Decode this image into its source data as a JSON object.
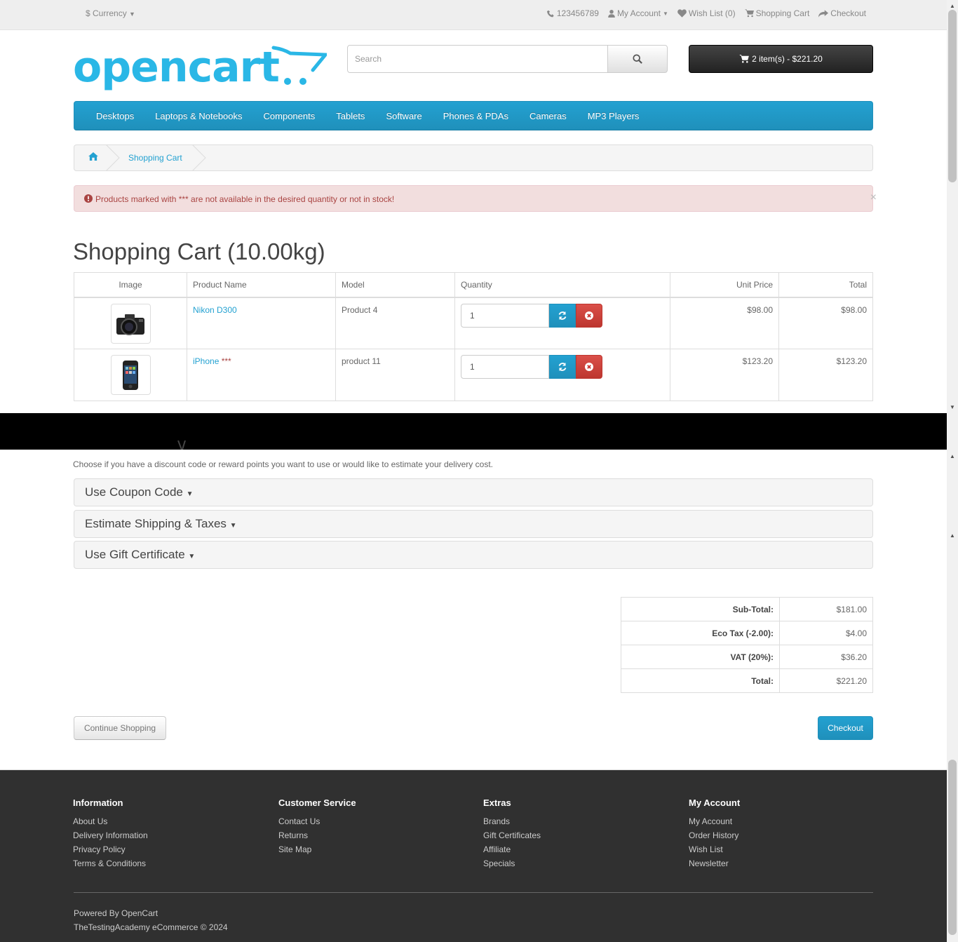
{
  "topbar": {
    "currency": "$ Currency",
    "phone": "123456789",
    "my_account": "My Account",
    "wish_list": "Wish List (0)",
    "shopping_cart": "Shopping Cart",
    "checkout": "Checkout"
  },
  "logo": {
    "text": "opencart"
  },
  "search": {
    "placeholder": "Search"
  },
  "cart_button": {
    "label": "2 item(s) - $221.20"
  },
  "menu": {
    "items": [
      "Desktops",
      "Laptops & Notebooks",
      "Components",
      "Tablets",
      "Software",
      "Phones & PDAs",
      "Cameras",
      "MP3 Players"
    ]
  },
  "breadcrumb": {
    "current": "Shopping Cart"
  },
  "alert": {
    "text": "Products marked with *** are not available in the desired quantity or not in stock!",
    "close": "×"
  },
  "page_title": "Shopping Cart  (10.00kg)",
  "cart_table": {
    "headers": [
      "Image",
      "Product Name",
      "Model",
      "Quantity",
      "Unit Price",
      "Total"
    ],
    "rows": [
      {
        "name": "Nikon D300",
        "stock_mark": "",
        "model": "Product 4",
        "quantity": "1",
        "unit_price": "$98.00",
        "total": "$98.00"
      },
      {
        "name": "iPhone",
        "stock_mark": " ***",
        "model": "product 11",
        "quantity": "1",
        "unit_price": "$123.20",
        "total": "$123.20"
      }
    ]
  },
  "next": {
    "description": "Choose if you have a discount code or reward points you want to use or would like to estimate your delivery cost.",
    "panels": [
      "Use Coupon Code",
      "Estimate Shipping & Taxes",
      "Use Gift Certificate"
    ]
  },
  "totals": [
    {
      "label": "Sub-Total:",
      "value": "$181.00"
    },
    {
      "label": "Eco Tax (-2.00):",
      "value": "$4.00"
    },
    {
      "label": "VAT (20%):",
      "value": "$36.20"
    },
    {
      "label": "Total:",
      "value": "$221.20"
    }
  ],
  "buttons": {
    "continue": "Continue Shopping",
    "checkout": "Checkout"
  },
  "footer": {
    "information": {
      "title": "Information",
      "links": [
        "About Us",
        "Delivery Information",
        "Privacy Policy",
        "Terms & Conditions"
      ]
    },
    "customer_service": {
      "title": "Customer Service",
      "links": [
        "Contact Us",
        "Returns",
        "Site Map"
      ]
    },
    "extras": {
      "title": "Extras",
      "links": [
        "Brands",
        "Gift Certificates",
        "Affiliate",
        "Specials"
      ]
    },
    "my_account": {
      "title": "My Account",
      "links": [
        "My Account",
        "Order History",
        "Wish List",
        "Newsletter"
      ]
    },
    "powered_prefix": "Powered By ",
    "powered_link": "OpenCart",
    "copyright": "TheTestingAcademy eCommerce © 2024"
  },
  "colors": {
    "accent": "#23a1d1",
    "danger": "#da4f49",
    "footer_bg": "#303030",
    "alert_bg": "#f2dede"
  },
  "icons": [
    "phone-icon",
    "user-icon",
    "heart-icon",
    "cart-icon",
    "share-icon",
    "search-icon",
    "home-icon",
    "exclamation-circle-icon",
    "refresh-icon",
    "times-circle-icon",
    "caret-down-icon"
  ]
}
